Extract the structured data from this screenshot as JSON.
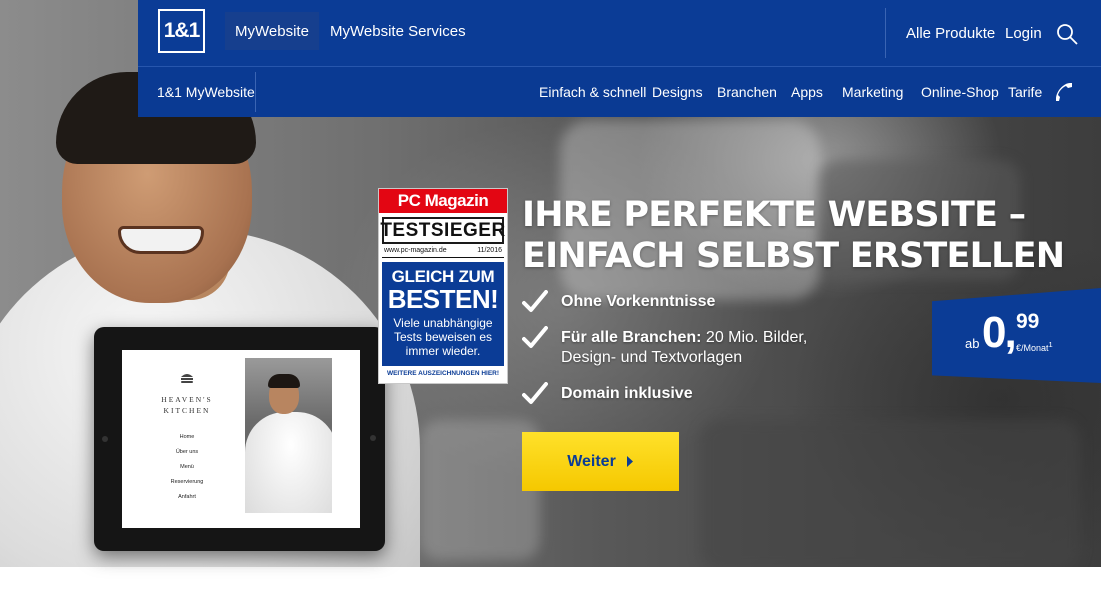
{
  "header": {
    "logo": "1&1",
    "tabs": [
      {
        "label": "MyWebsite",
        "active": true
      },
      {
        "label": "MyWebsite Services",
        "active": false
      }
    ],
    "right_links": [
      "Alle Produkte",
      "Login"
    ],
    "search_icon": "search-icon"
  },
  "subnav": {
    "brand": "1&1 MyWebsite",
    "items": [
      "Einfach & schnell",
      "Designs",
      "Branchen",
      "Apps",
      "Marketing",
      "Online-Shop",
      "Tarife"
    ],
    "phone_icon": "phone-icon"
  },
  "badge": {
    "publisher": "PC Magazin",
    "award": "TESTSIEGER",
    "site": "www.pc-magazin.de",
    "issue": "11/2016",
    "line1": "GLEICH ZUM",
    "line2": "BESTEN!",
    "sub": "Viele unabhängige Tests beweisen es immer wieder.",
    "link": "WEITERE AUSZEICHNUNGEN HIER!"
  },
  "hero": {
    "headline_line1": "IHRE PERFEKTE WEBSITE –",
    "headline_line2": "EINFACH SELBST ERSTELLEN",
    "features": [
      {
        "bold": "Ohne Vorkenntnisse",
        "rest": ""
      },
      {
        "bold": "Für alle Branchen:",
        "rest": " 20 Mio. Bilder,",
        "line2": "Design- und Textvorlagen"
      },
      {
        "bold": "Domain inklusive",
        "rest": ""
      }
    ],
    "cta_label": "Weiter"
  },
  "price": {
    "prefix": "ab",
    "euros": "0,",
    "cents": "99",
    "unit": "€/Monat",
    "footnote": "1"
  },
  "tablet": {
    "site_title_line1": "HEAVEN'S",
    "site_title_line2": "KITCHEN",
    "menu": [
      "Home",
      "Über uns",
      "Menü",
      "Reservierung",
      "Anfahrt"
    ]
  },
  "colors": {
    "brand_blue": "#0b3c96",
    "cta_yellow": "#f5c800",
    "badge_red": "#e30613"
  }
}
